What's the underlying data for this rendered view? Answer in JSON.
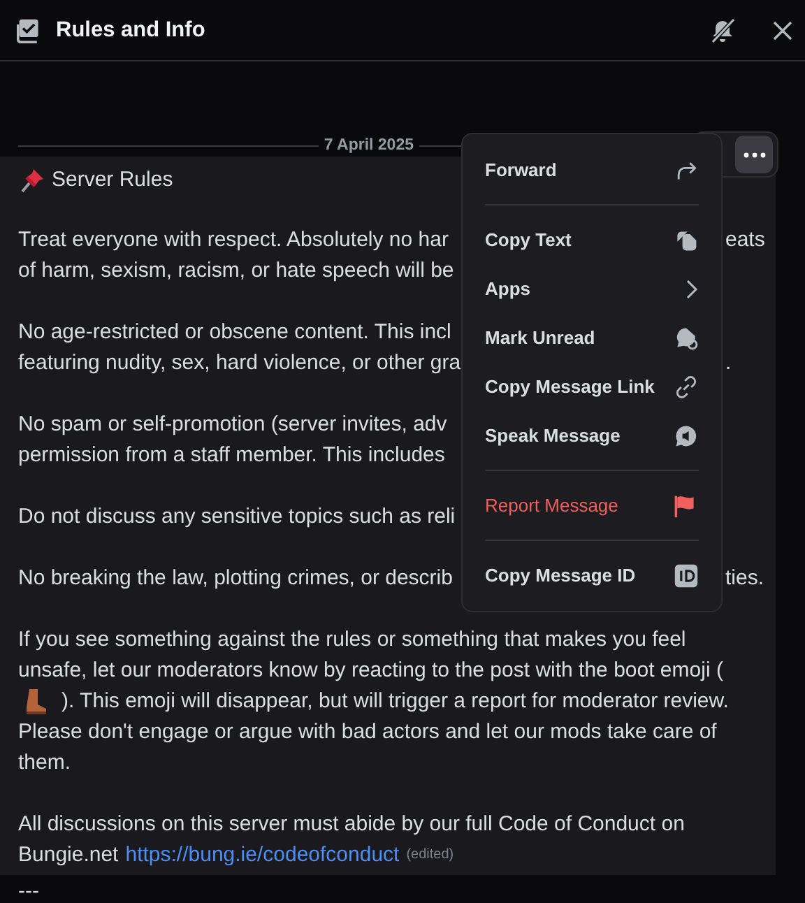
{
  "header": {
    "title": "Rules and Info"
  },
  "date_divider": "7 April 2025",
  "message": {
    "title": "Server Rules",
    "paragraphs": [
      {
        "lines": [
          {
            "left": "Treat everyone with respect. Absolutely no har",
            "right": "eats"
          },
          {
            "left": "of harm, sexism, racism, or hate speech will be"
          }
        ]
      },
      {
        "lines": [
          {
            "left": "No age-restricted or obscene content. This incl"
          },
          {
            "left": "featuring nudity, sex, hard violence, or other gra",
            "right": "."
          }
        ]
      },
      {
        "lines": [
          {
            "left": "No spam or self-promotion (server invites, adv"
          },
          {
            "left": "permission from a staff member. This includes"
          }
        ]
      },
      {
        "lines": [
          {
            "left": "Do not discuss any sensitive topics such as reli"
          }
        ]
      },
      {
        "lines": [
          {
            "left": "No breaking the law, plotting crimes, or describ",
            "right": "ties."
          }
        ]
      }
    ],
    "report_paragraph": {
      "lines": [
        {
          "kind": "text",
          "text": "If you see something against the rules or something that makes you feel"
        },
        {
          "kind": "text",
          "text": "unsafe, let our moderators know by reacting to the post with the boot emoji ("
        },
        {
          "kind": "boot_emoji",
          "text": "). This emoji will disappear, but will trigger a report for moderator review."
        },
        {
          "kind": "text",
          "text": "Please don't engage or argue with bad actors and let our mods take care of"
        },
        {
          "kind": "text",
          "text": "them."
        }
      ]
    },
    "closing": {
      "line_1": "All discussions on this server must abide by our full Code of Conduct on",
      "line_2": "Bungie.net",
      "link": "https://bung.ie/codeofconduct",
      "edited": "(edited)"
    }
  },
  "context_menu": {
    "groups": [
      [
        {
          "label": "Forward",
          "kind": "forward",
          "danger": false
        }
      ],
      [
        {
          "label": "Copy Text",
          "kind": "copy",
          "danger": false
        },
        {
          "label": "Apps",
          "kind": "submenu",
          "danger": false
        },
        {
          "label": "Mark Unread",
          "kind": "unread",
          "danger": false
        },
        {
          "label": "Copy Message Link",
          "kind": "link",
          "danger": false
        },
        {
          "label": "Speak Message",
          "kind": "speak",
          "danger": false
        }
      ],
      [
        {
          "label": "Report Message",
          "kind": "report",
          "danger": true
        }
      ],
      [
        {
          "label": "Copy Message ID",
          "kind": "id",
          "danger": false
        }
      ]
    ]
  },
  "footer": "---"
}
